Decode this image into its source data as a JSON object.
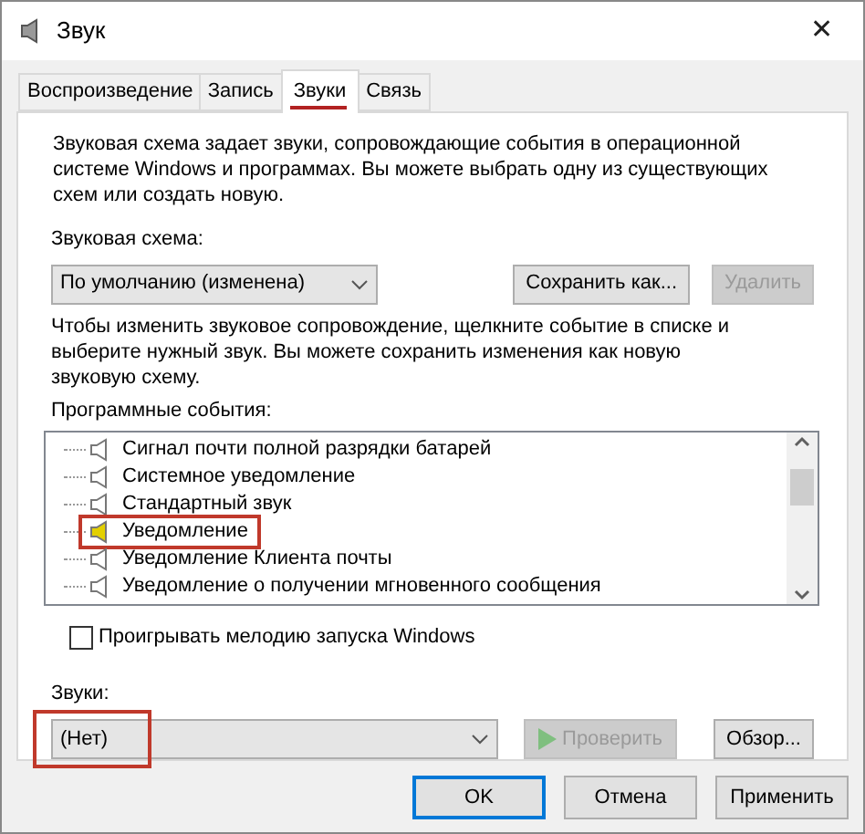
{
  "window": {
    "title": "Звук",
    "close": "✕"
  },
  "tabs": [
    {
      "label": "Воспроизведение",
      "selected": false
    },
    {
      "label": "Запись",
      "selected": false
    },
    {
      "label": "Звуки",
      "selected": true
    },
    {
      "label": "Связь",
      "selected": false
    }
  ],
  "description": "Звуковая схема задает звуки, сопровождающие события в операционной системе Windows и программах. Вы можете выбрать одну из существующих схем или создать новую.",
  "scheme": {
    "label": "Звуковая схема:",
    "value": "По умолчанию (изменена)",
    "buttons": [
      {
        "label": "Сохранить как...",
        "disabled": false
      },
      {
        "label": "Удалить",
        "disabled": true
      }
    ]
  },
  "hint": "Чтобы изменить звуковое сопровождение, щелкните событие в списке и выберите нужный звук. Вы можете сохранить изменения как новую звуковую схему.",
  "events": {
    "label": "Программные события:",
    "items": [
      {
        "label": "Сигнал почти полной разрядки батарей",
        "has_sound": false,
        "annotated": false
      },
      {
        "label": "Системное уведомление",
        "has_sound": false,
        "annotated": false
      },
      {
        "label": "Стандартный звук",
        "has_sound": false,
        "annotated": false
      },
      {
        "label": "Уведомление",
        "has_sound": true,
        "annotated": true
      },
      {
        "label": "Уведомление Клиента почты",
        "has_sound": false,
        "annotated": false
      },
      {
        "label": "Уведомление о получении мгновенного сообщения",
        "has_sound": false,
        "annotated": false
      }
    ]
  },
  "startup": {
    "label": "Проигрывать мелодию запуска Windows",
    "checked": false
  },
  "sounds": {
    "label": "Звуки:",
    "value": "(Нет)",
    "annotated": true,
    "buttons": [
      {
        "kind": "play",
        "label": "Проверить",
        "disabled": true
      },
      {
        "kind": "browse",
        "label": "Обзор...",
        "disabled": false
      }
    ]
  },
  "footer": [
    {
      "label": "OK",
      "default": true
    },
    {
      "label": "Отмена",
      "default": false
    },
    {
      "label": "Применить",
      "default": false
    }
  ]
}
